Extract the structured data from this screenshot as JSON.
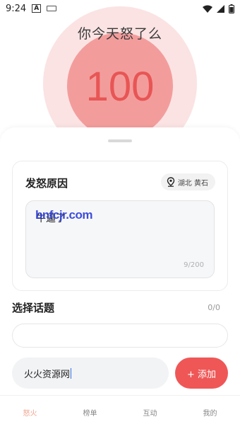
{
  "status_bar": {
    "time": "9:24"
  },
  "anger": {
    "question": "你今天怒了么",
    "value": "100"
  },
  "reason_card": {
    "title": "发怒原因",
    "location": "湖北 黄石",
    "input_text": "牛逼了",
    "watermark": "bnfcjr.com",
    "char_count": "9/200"
  },
  "topic": {
    "title": "选择话题",
    "count": "0/0"
  },
  "compose": {
    "input_value": "火火资源网",
    "add_label": "+ 添加"
  },
  "nav": [
    {
      "label": "怒火"
    },
    {
      "label": "榜单"
    },
    {
      "label": "互动"
    },
    {
      "label": "我的"
    }
  ],
  "colors": {
    "accent": "#ef5757",
    "anger_circle": "#f29d9c",
    "halo": "#fbe3e3",
    "nav_active": "#f0a38c"
  }
}
